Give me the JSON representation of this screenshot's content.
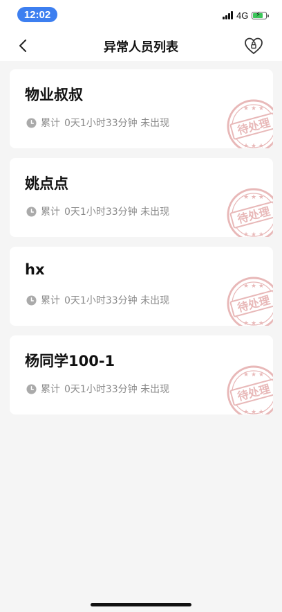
{
  "status_bar": {
    "time": "12:02",
    "network": "4G"
  },
  "nav": {
    "title": "异常人员列表"
  },
  "stamp_text": "待处理",
  "items": [
    {
      "name": "物业叔叔",
      "label": "累计",
      "duration": "0天1小时33分钟 未出现"
    },
    {
      "name": "姚点点",
      "label": "累计",
      "duration": "0天1小时33分钟 未出现"
    },
    {
      "name": "hx",
      "label": "累计",
      "duration": "0天1小时33分钟 未出现"
    },
    {
      "name": "杨同学100-1",
      "label": "累计",
      "duration": "0天1小时33分钟 未出现"
    }
  ],
  "colors": {
    "accent": "#3d7ff0",
    "stamp": "#e8b8b8",
    "battery": "#3cc65a"
  }
}
